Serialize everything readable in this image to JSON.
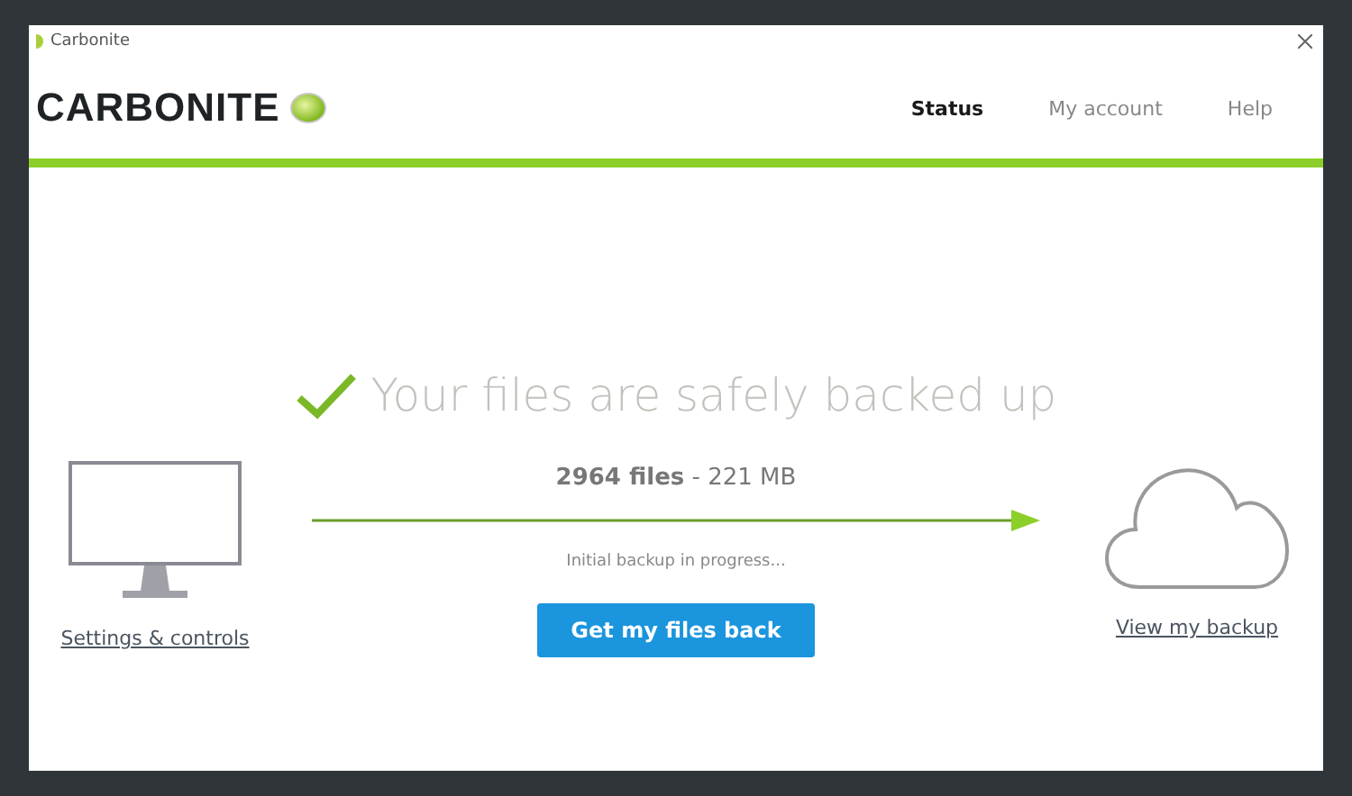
{
  "window": {
    "title": "Carbonite"
  },
  "logo": {
    "text": "CARBONITE"
  },
  "tabs": [
    {
      "label": "Status",
      "selected": true
    },
    {
      "label": "My account",
      "selected": false
    },
    {
      "label": "Help",
      "selected": false
    }
  ],
  "status": {
    "headline": "Your files are safely backed up",
    "summary": "**2964 files** - 221 MB",
    "progress_note": "Initial backup in progress...",
    "button": "Get my files back"
  },
  "links": {
    "left": "Settings & controls",
    "right": "View my backup"
  }
}
